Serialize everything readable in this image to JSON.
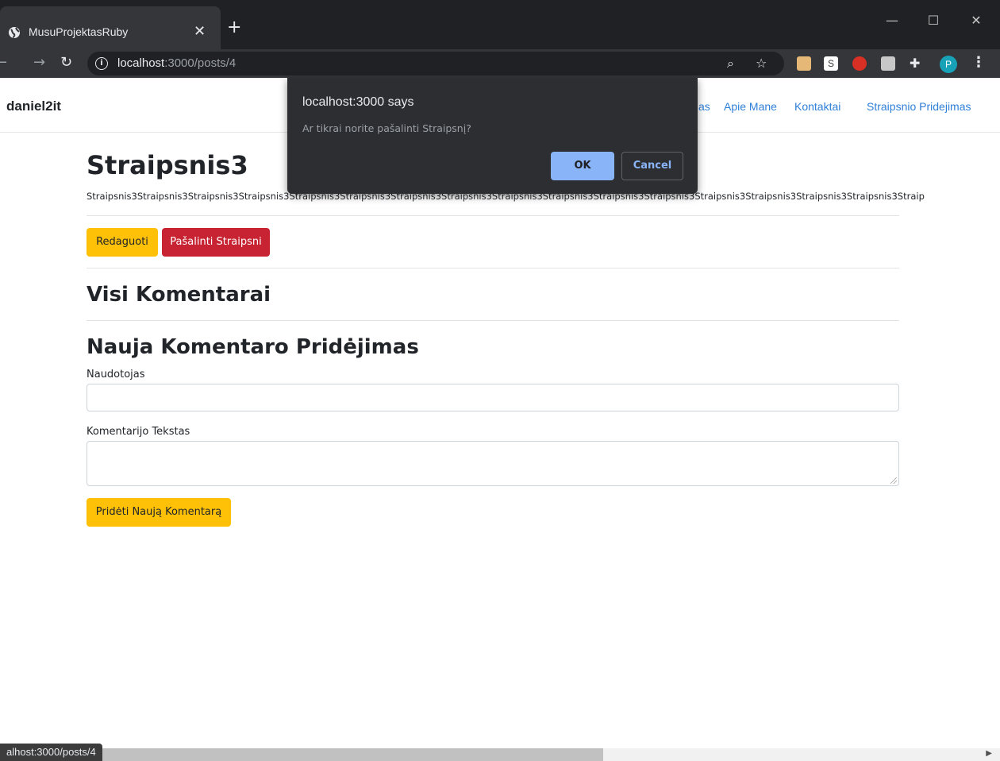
{
  "browser": {
    "tab_title": "MusuProjektasRuby",
    "tab_close": "✕",
    "new_tab": "+",
    "url_host": "localhost",
    "url_path": ":3000/posts/4",
    "profile_initial": "P",
    "status_url": "alhost:3000/posts/4"
  },
  "navbar": {
    "brand": "daniel2it",
    "links": [
      "as",
      "Apie Mane",
      "Kontaktai",
      "Straipsnio Pridejimas"
    ]
  },
  "post": {
    "title": "Straipsnis3",
    "body": "Straipsnis3Straipsnis3Straipsnis3Straipsnis3Straipsnis3Straipsnis3Straipsnis3Straipsnis3Straipsnis3Straipsnis3Straipsnis3Straipsnis3Straipsnis3Straipsnis3Straipsnis3Straipsnis3Straip",
    "edit_label": "Redaguoti",
    "delete_label": "Pašalinti Straipsni"
  },
  "comments": {
    "heading": "Visi Komentarai"
  },
  "new_comment": {
    "heading": "Nauja Komentaro Pridėjimas",
    "user_label": "Naudotojas",
    "text_label": "Komentarijo Tekstas",
    "submit_label": "Pridėti Naują Komentarą"
  },
  "dialog": {
    "title": "localhost:3000 says",
    "message": "Ar tikrai norite pašalinti Straipsnį?",
    "ok_label": "OK",
    "cancel_label": "Cancel"
  },
  "colors": {
    "warning": "#ffc107",
    "danger": "#c82333",
    "link": "#2f7fd8",
    "dialog_bg": "#2d2e31",
    "ok_button": "#8ab4f8"
  }
}
